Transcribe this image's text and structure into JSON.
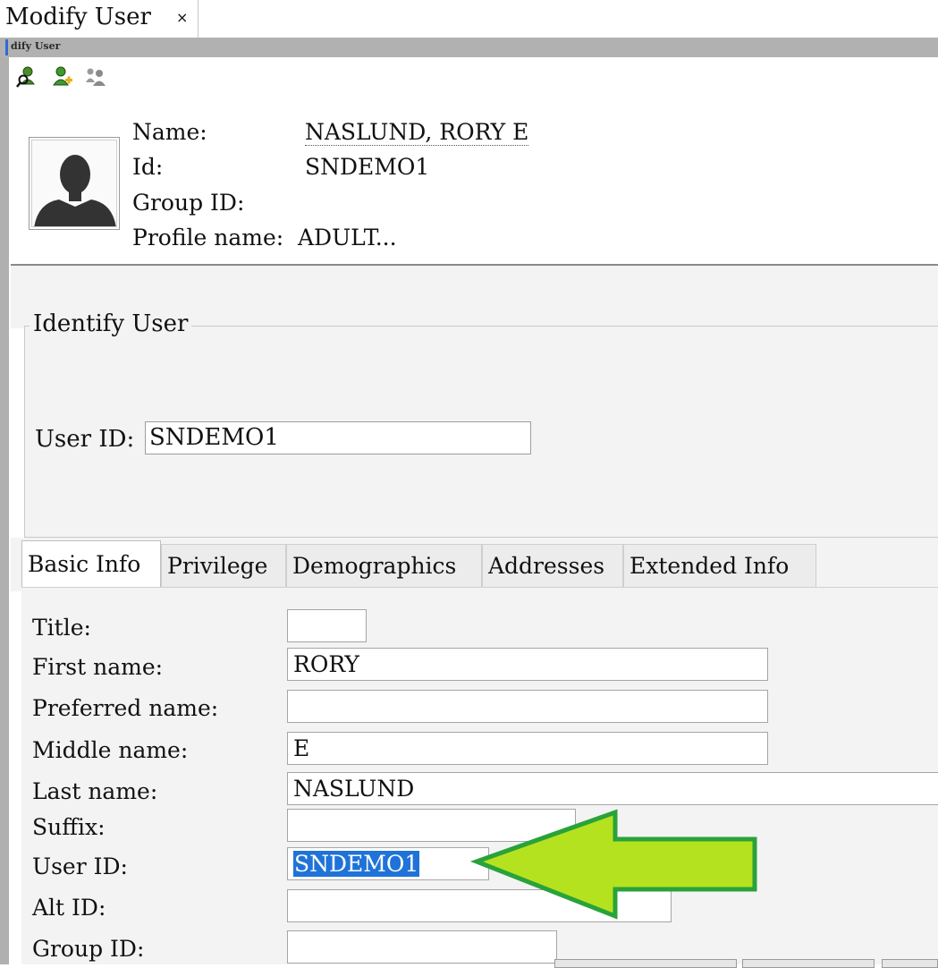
{
  "window": {
    "tab_title": "Modify User",
    "tab_close": "×",
    "title_bar": "dify User"
  },
  "toolbar": {
    "icons": [
      "search-user-icon",
      "add-user-icon",
      "users-group-icon"
    ]
  },
  "header": {
    "name_label": "Name:",
    "name_value": "NASLUND, RORY E",
    "id_label": "Id:",
    "id_value": "SNDEMO1",
    "group_label": "Group ID:",
    "group_value": "",
    "profile_label": "Profile name:",
    "profile_value": "ADULT..."
  },
  "identify": {
    "legend": "Identify User",
    "user_id_label": "User ID:",
    "user_id_value": "SNDEMO1"
  },
  "tabs": [
    {
      "label": "Basic Info",
      "active": true
    },
    {
      "label": "Privilege",
      "active": false
    },
    {
      "label": "Demographics",
      "active": false
    },
    {
      "label": "Addresses",
      "active": false
    },
    {
      "label": "Extended Info",
      "active": false
    }
  ],
  "form": {
    "title": {
      "label": "Title:",
      "value": ""
    },
    "first_name": {
      "label": "First name:",
      "value": "RORY"
    },
    "preferred_name": {
      "label": "Preferred name:",
      "value": ""
    },
    "middle_name": {
      "label": "Middle name:",
      "value": "E"
    },
    "last_name": {
      "label": "Last name:",
      "value": "NASLUND"
    },
    "suffix": {
      "label": "Suffix:",
      "value": ""
    },
    "user_id": {
      "label": "User ID:",
      "value": "SNDEMO1"
    },
    "alt_id": {
      "label": "Alt ID:",
      "value": ""
    },
    "group_id": {
      "label": "Group ID:",
      "value": ""
    }
  },
  "annotation": {
    "arrow_color": "#b5e21f",
    "arrow_outline": "#2aa23a"
  },
  "colors": {
    "selection": "#1f73d8",
    "title_bar": "#b1b1b1",
    "panel": "#f3f3f3"
  }
}
